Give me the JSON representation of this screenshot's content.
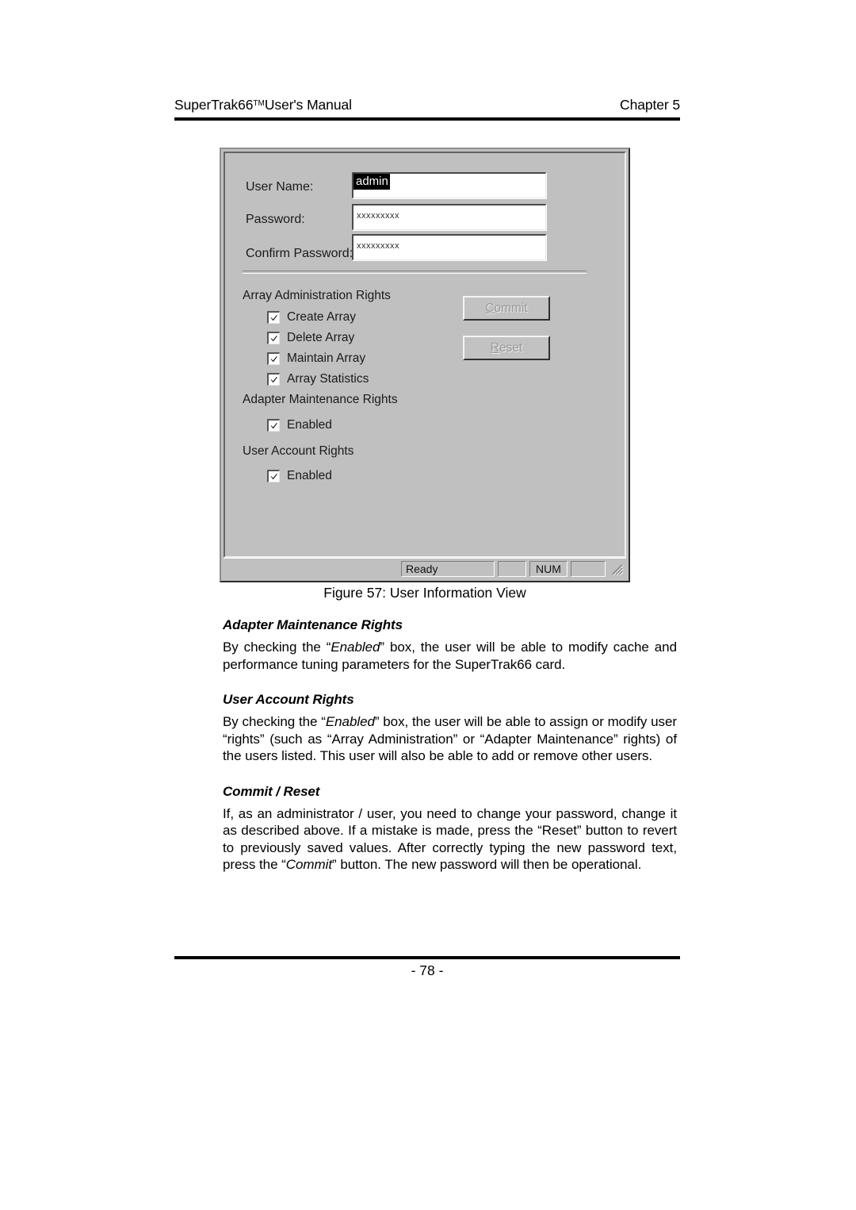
{
  "page": {
    "header_left": "SuperTrak66",
    "header_trademark": "TM",
    "header_left_rest": "User's Manual",
    "header_right": "Chapter 5",
    "footer": "- 78 -"
  },
  "figure": {
    "caption": "Figure 57: User Information View"
  },
  "dialog": {
    "fields": [
      {
        "label": "User Name:",
        "value": "admin",
        "masked": false,
        "selected": true
      },
      {
        "label": "Password:",
        "value": "xxxxxxxxx",
        "masked": true,
        "selected": false
      },
      {
        "label": "Confirm Password:",
        "value": "xxxxxxxxx",
        "masked": true,
        "selected": false
      }
    ],
    "groups": [
      {
        "label": "Array Administration Rights",
        "items": [
          {
            "label": "Create Array",
            "checked": true
          },
          {
            "label": "Delete Array",
            "checked": true
          },
          {
            "label": "Maintain Array",
            "checked": true
          },
          {
            "label": "Array Statistics",
            "checked": true
          }
        ]
      },
      {
        "label": "Adapter Maintenance Rights",
        "items": [
          {
            "label": "Enabled",
            "checked": true
          }
        ]
      },
      {
        "label": "User Account Rights",
        "items": [
          {
            "label": "Enabled",
            "checked": true
          }
        ]
      }
    ],
    "buttons": [
      {
        "accel": "C",
        "rest": "ommit",
        "label": "Commit",
        "disabled": true
      },
      {
        "accel": "R",
        "rest": "eset",
        "label": "Reset",
        "disabled": true
      }
    ],
    "statusbar": {
      "ready": "Ready",
      "pane_blank_1": "",
      "num": "NUM",
      "pane_blank_2": ""
    },
    "colors": {
      "face": "#c0c0c0",
      "field": "#ffffff",
      "selection": "#000000"
    }
  },
  "sections": [
    {
      "heading": "Adapter Maintenance Rights",
      "body_html": "By checking the “<i>Enabled</i>” box, the user will be able to modify cache and performance tuning parameters for the SuperTrak66 card."
    },
    {
      "heading": "User Account Rights",
      "body_html": "By checking the “<i>Enabled</i>” box, the user will be able to assign or modify user “rights” (such as “Array Administration” or “Adapter Maintenance” rights) of the users listed. This user will also be able to add or remove other users."
    },
    {
      "heading": "Commit / Reset",
      "body_html": "If, as an administrator / user, you need to change your password, change it as described above. If a mistake is made, press the “Reset” button to revert to previously saved values. After correctly typing the new password text, press the “<i>Commit</i>” button. The new password will then be operational."
    }
  ]
}
